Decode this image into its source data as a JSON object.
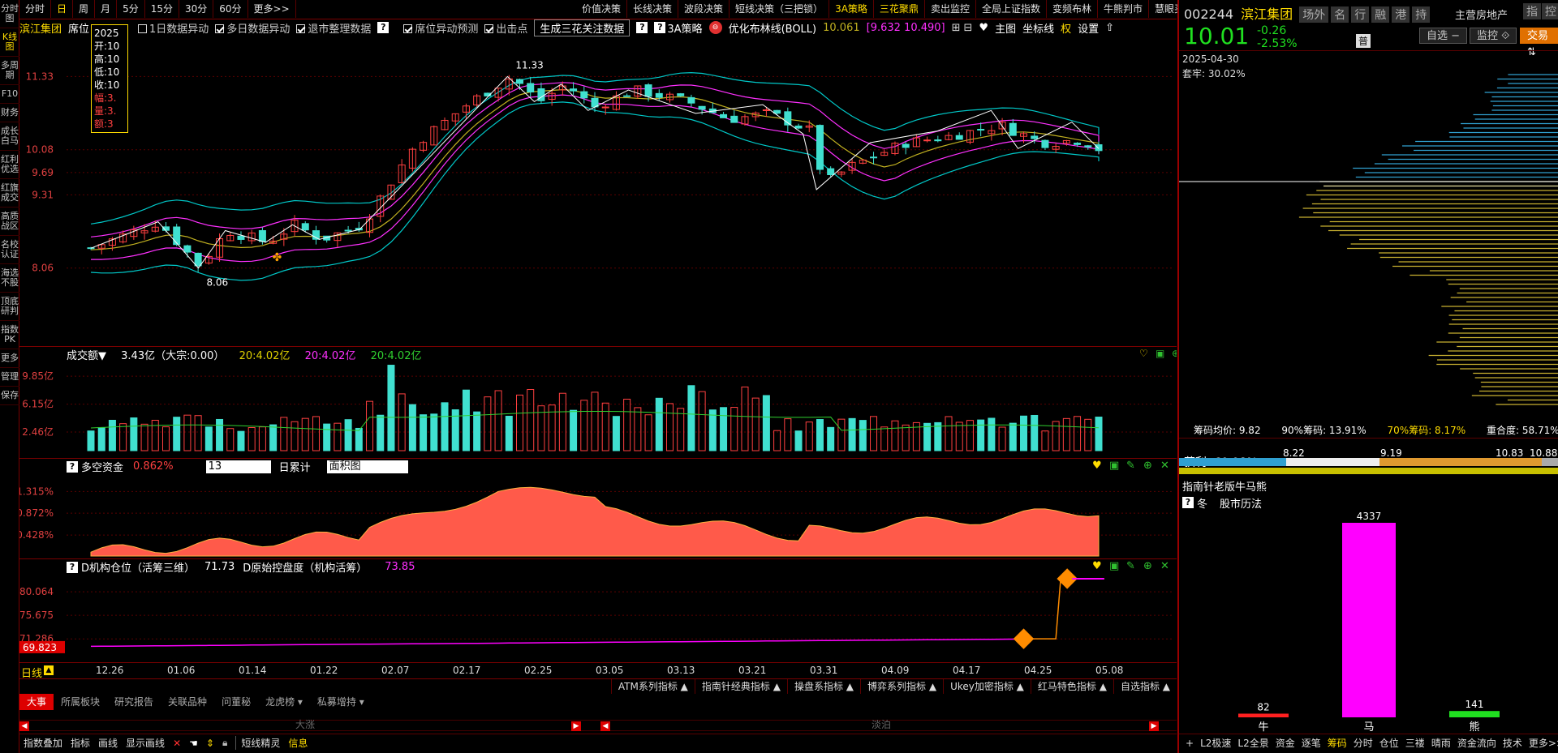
{
  "sidebar": [
    "分时图",
    "K线图",
    "多周期",
    "F10",
    "财务",
    "成长白马",
    "红利优选",
    "红旗成交",
    "高质战区",
    "名校认证",
    "海选不股",
    "顶底研判",
    "指数PK",
    "更多",
    "管理",
    "保存"
  ],
  "periods": [
    "分时",
    "日",
    "周",
    "月",
    "5分",
    "15分",
    "30分",
    "60分",
    "更多>>"
  ],
  "strategies": [
    "价值决策",
    "长线决策",
    "波段决策",
    "短线决策（三把锁）",
    "3A策略",
    "三花聚鼎",
    "卖出监控",
    "全局上证指数",
    "变频布林",
    "牛熊判市",
    "慧眼买关"
  ],
  "info": {
    "stock_name": "滨江集团",
    "seat": "席位",
    "opt1": "1日数据异动",
    "opt2": "多日数据异动",
    "opt3": "退市整理数据",
    "opt4": "席位异动预测",
    "opt5": "出击点",
    "gen_btn": "生成三花关注数据",
    "strategy": "3A策略",
    "boll_label": "优化布林线(BOLL)",
    "boll_mid": "10.061",
    "boll_range": "[9.632  10.490]",
    "main_chart": "主图",
    "coord": "坐标线",
    "weight": "权",
    "settings": "设置"
  },
  "popup": [
    "2025",
    "开:10",
    "高:10",
    "低:10",
    "收:10",
    "幅:3.",
    "量:3.",
    "额:3"
  ],
  "price_axis": [
    "11.33",
    "10.08",
    "9.69",
    "9.31",
    "8.06"
  ],
  "high_label": "11.33",
  "low_label": "8.06",
  "vol": {
    "title": "成交额▼",
    "value": "3.43亿（大宗:0.00）",
    "ma1": "20:4.02亿",
    "ma2": "20:4.02亿",
    "ma3": "20:4.02亿",
    "axis": [
      "9.85亿",
      "6.15亿",
      "2.46亿"
    ]
  },
  "duokong": {
    "title": "多空资金",
    "value": "0.862%",
    "period": "13",
    "accum": "日累计",
    "chart": "面积图",
    "axis": [
      "1.315%",
      "0.872%",
      "0.428%"
    ]
  },
  "jigou": {
    "title": "D机构仓位（活筹三维）",
    "value": "71.73",
    "title2": "D原始控盘度（机构活筹）",
    "value2": "73.85",
    "axis": [
      "80.064",
      "75.675",
      "71.286"
    ],
    "tag": "69.823"
  },
  "dates": [
    "12.26",
    "01.06",
    "01.14",
    "01.22",
    "02.07",
    "02.17",
    "02.25",
    "03.05",
    "03.13",
    "03.21",
    "03.31",
    "04.09",
    "04.17",
    "04.25",
    "05.08"
  ],
  "day_line": "日线",
  "ind_bar": [
    "ATM系列指标 ▲",
    "指南针经典指标 ▲",
    "操盘系指标 ▲",
    "博弈系列指标 ▲",
    "Ukey加密指标 ▲",
    "红马特色指标 ▲",
    "自选指标 ▲"
  ],
  "tabs": [
    "大事",
    "所属板块",
    "研究报告",
    "关联品种",
    "问董秘",
    "龙虎榜 ▾",
    "私募增持 ▾"
  ],
  "scroll_labels": [
    "大涨",
    "淡泊"
  ],
  "footer": [
    "指数叠加",
    "指标",
    "画线",
    "显示画线",
    "短线精灵",
    "信息"
  ],
  "right": {
    "code": "002244",
    "name": "滨江集团",
    "badges": [
      "场外",
      "名",
      "行",
      "融",
      "港",
      "持"
    ],
    "industry": "主营房地产",
    "idx": "指",
    "ctrl": "控",
    "price": "10.01",
    "chg": "-0.26",
    "pct": "-2.53%",
    "tag": "普",
    "btn_self": "自选 −",
    "btn_monitor": "监控 ⟐",
    "btn_trade": "交易 ⇅",
    "date": "2025-04-30",
    "trapped": "套牢: 30.02%",
    "chip_avg": "筹码均价: 9.82",
    "chip90": "90%筹码: 13.91%",
    "chip70": "70%筹码: 8.17%",
    "overlap": "重合度: 58.71%",
    "profit": "获利: 69.98%",
    "scale": [
      "8.22",
      "9.19",
      "10.83",
      "10.88"
    ],
    "bullbear_title": "指南针老版牛马熊",
    "season": "冬",
    "history": "股市历法",
    "bars": [
      {
        "label": "牛",
        "value": 82,
        "color": "#ff2020"
      },
      {
        "label": "马",
        "value": 4337,
        "color": "#ff00ff"
      },
      {
        "label": "熊",
        "value": 141,
        "color": "#20e020"
      }
    ],
    "footer": [
      "+",
      "L2极速",
      "L2全景",
      "资金",
      "逐笔",
      "筹码",
      "分时",
      "仓位",
      "三褛",
      "晴雨",
      "资金流向",
      "技术",
      "更多>>"
    ]
  },
  "colors": {
    "up": "#ff4040",
    "down": "#40e0d0",
    "boll_up": "#00c8c8",
    "boll_mid": "#c0b020",
    "boll_lo": "#ff30ff",
    "accent": "#ffdc00"
  }
}
